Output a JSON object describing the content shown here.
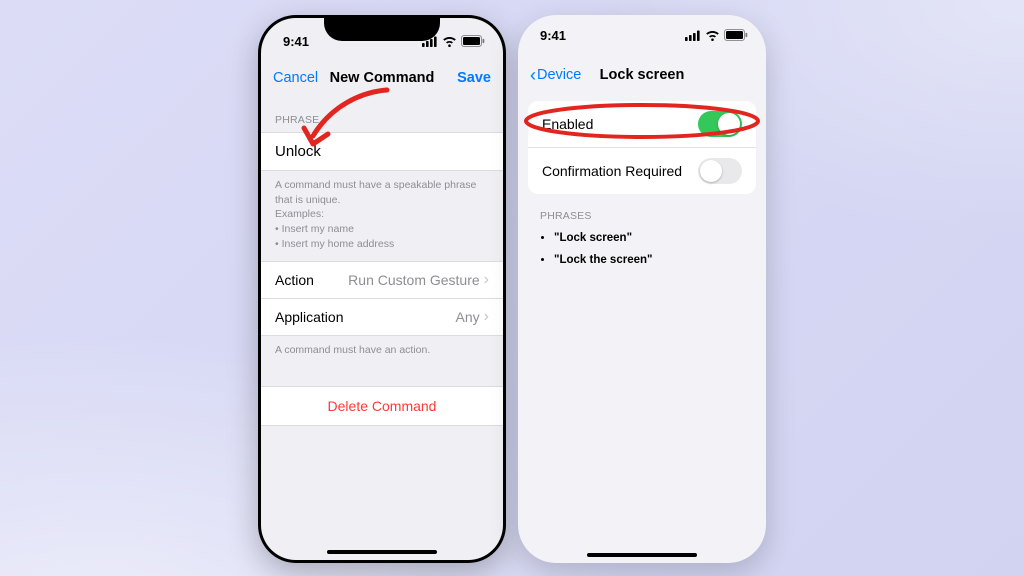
{
  "status": {
    "time": "9:41"
  },
  "left": {
    "nav": {
      "cancel": "Cancel",
      "title": "New Command",
      "save": "Save"
    },
    "phrase_header": "PHRASE",
    "phrase_value": "Unlock",
    "phrase_note_line1": "A command must have a speakable phrase that is unique.",
    "phrase_note_line2": "Examples:",
    "phrase_note_line3": "• Insert my name",
    "phrase_note_line4": "• Insert my home address",
    "action_label": "Action",
    "action_value": "Run Custom Gesture",
    "application_label": "Application",
    "application_value": "Any",
    "action_note": "A command must have an action.",
    "delete": "Delete Command"
  },
  "right": {
    "nav": {
      "back": "Device",
      "title": "Lock screen"
    },
    "enabled_label": "Enabled",
    "confirm_label": "Confirmation Required",
    "phrases_header": "PHRASES",
    "phrase1": "\"Lock screen\"",
    "phrase2": "\"Lock the screen\""
  }
}
